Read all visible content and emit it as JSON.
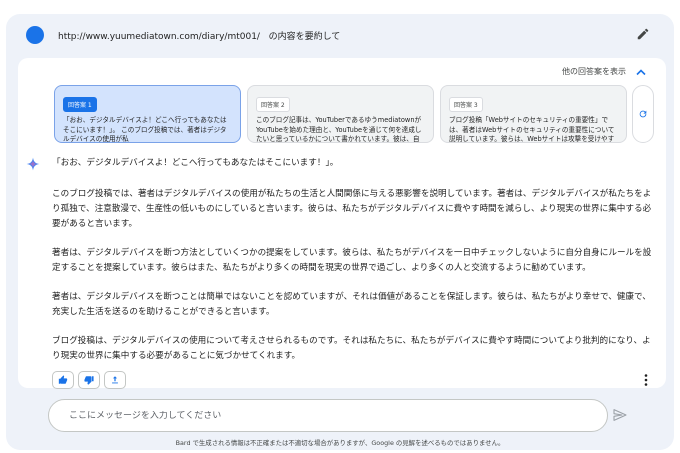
{
  "prompt": {
    "url": "http://www.yuumediatown.com/diary/mt001/",
    "suffix": "の内容を要約して"
  },
  "drafts_header": {
    "label": "他の回答案を表示"
  },
  "drafts": [
    {
      "label": "回答案 1",
      "text": "「おお、デジタルデバイスよ！どこへ行ってもあなたはそこにいます！」。 このブログ投稿では、著者はデジタルデバイスの使用が私"
    },
    {
      "label": "回答案 2",
      "text": "このブログ記事は、YouTuberであるゆうmediatownがYouTubeを始めた理由と、YouTubeを通じて何を達成したいと思っているかについて書かれています。彼は、自分のスキルを他の人と共有し、自分の視点から世界を伝えたい"
    },
    {
      "label": "回答案 3",
      "text": "ブログ投稿「Webサイトのセキュリティの重要性」では、著者はWebサイトのセキュリティの重要性について説明しています。彼らは、Webサイトは攻撃を受けやすく、攻撃者は個人情報、クレジットカード情報、その他の機密情報"
    }
  ],
  "answer": {
    "title": "「おお、デジタルデバイスよ！どこへ行ってもあなたはそこにいます！」。",
    "paragraphs": [
      "このブログ投稿では、著者はデジタルデバイスの使用が私たちの生活と人間関係に与える悪影響を説明しています。著者は、デジタルデバイスが私たちをより孤独で、注意散漫で、生産性の低いものにしていると言います。彼らは、私たちがデジタルデバイスに費やす時間を減らし、より現実の世界に集中する必要があると言います。",
      "著者は、デジタルデバイスを断つ方法としていくつかの提案をしています。彼らは、私たちがデバイスを一日中チェックしないように自分自身にルールを設定することを提案しています。彼らはまた、私たちがより多くの時間を現実の世界で過ごし、より多くの人と交流するように勧めています。",
      "著者は、デジタルデバイスを断つことは簡単ではないことを認めていますが、それは価値があることを保証します。彼らは、私たちがより幸せで、健康で、充実した生活を送るのを助けることができると言います。",
      "ブログ投稿は、デジタルデバイスの使用について考えさせられるものです。それは私たちに、私たちがデバイスに費やす時間についてより批判的になり、より現実の世界に集中する必要があることに気づかせてくれます。"
    ]
  },
  "input": {
    "placeholder": "ここにメッセージを入力してください"
  },
  "footer": {
    "disclaimer": "Bard で生成される情報は不正確または不適切な場合がありますが、Google の見解を述べるものではありません。"
  },
  "colors": {
    "accent": "#1a73e8",
    "selected_draft": "#d3e3fd",
    "frame": "#eef2f9"
  }
}
